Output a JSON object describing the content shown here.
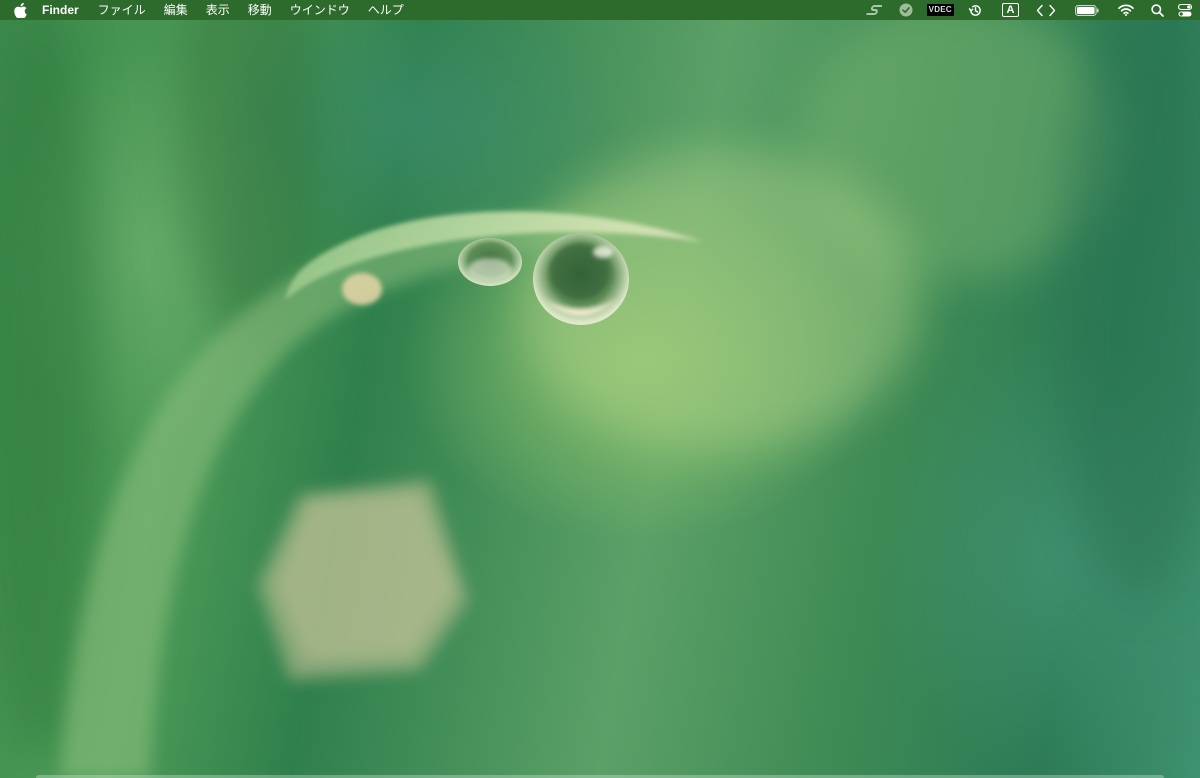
{
  "menubar": {
    "apple_menu": "apple-icon",
    "app_name": "Finder",
    "items": [
      "ファイル",
      "編集",
      "表示",
      "移動",
      "ウインドウ",
      "ヘルプ"
    ],
    "status_icons": [
      "scrivener-s-icon",
      "shield-check-icon",
      "vpn-icon",
      "time-machine-icon",
      "input-source-icon",
      "code-brackets-icon",
      "battery-icon",
      "wifi-icon",
      "search-icon",
      "control-center-icon"
    ],
    "vpn_label": "VDEC",
    "input_source_label": "A"
  },
  "colors": {
    "menubar_bg": "#2d6b2d",
    "menubar_text": "#ffffff",
    "wallpaper_primary": "#4f9d58"
  }
}
